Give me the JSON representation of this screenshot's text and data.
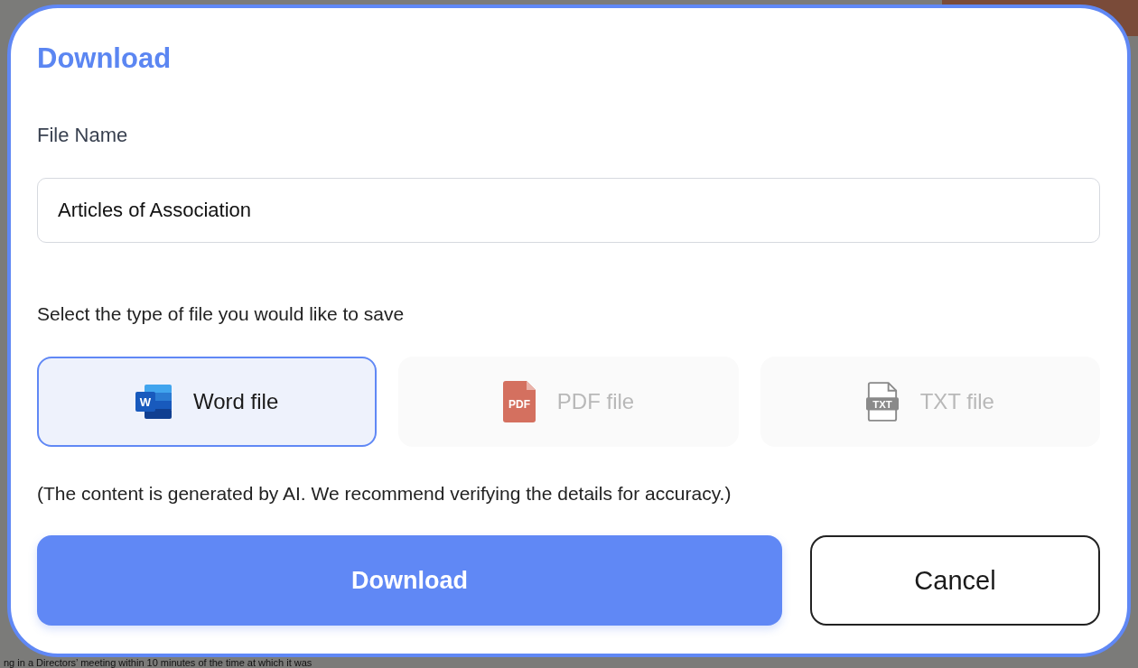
{
  "backdrop": {
    "text_line": "ng in a Directors’ meeting within 10 minutes of the time at which it was"
  },
  "dialog": {
    "title": "Download",
    "file_name": {
      "label": "File Name",
      "value": "Articles of Association"
    },
    "type_prompt": "Select the type of file you would like to save",
    "file_types": [
      {
        "kind": "word",
        "label": "Word file",
        "icon_text": "W",
        "selected": true,
        "disabled": false
      },
      {
        "kind": "pdf",
        "label": "PDF file",
        "icon_text": "PDF",
        "selected": false,
        "disabled": true
      },
      {
        "kind": "txt",
        "label": "TXT file",
        "icon_text": "TXT",
        "selected": false,
        "disabled": true
      }
    ],
    "note": "(The content is generated by AI. We recommend verifying the details for accuracy.)",
    "buttons": [
      {
        "kind": "primary",
        "label": "Download"
      },
      {
        "kind": "secondary",
        "label": "Cancel"
      }
    ]
  }
}
